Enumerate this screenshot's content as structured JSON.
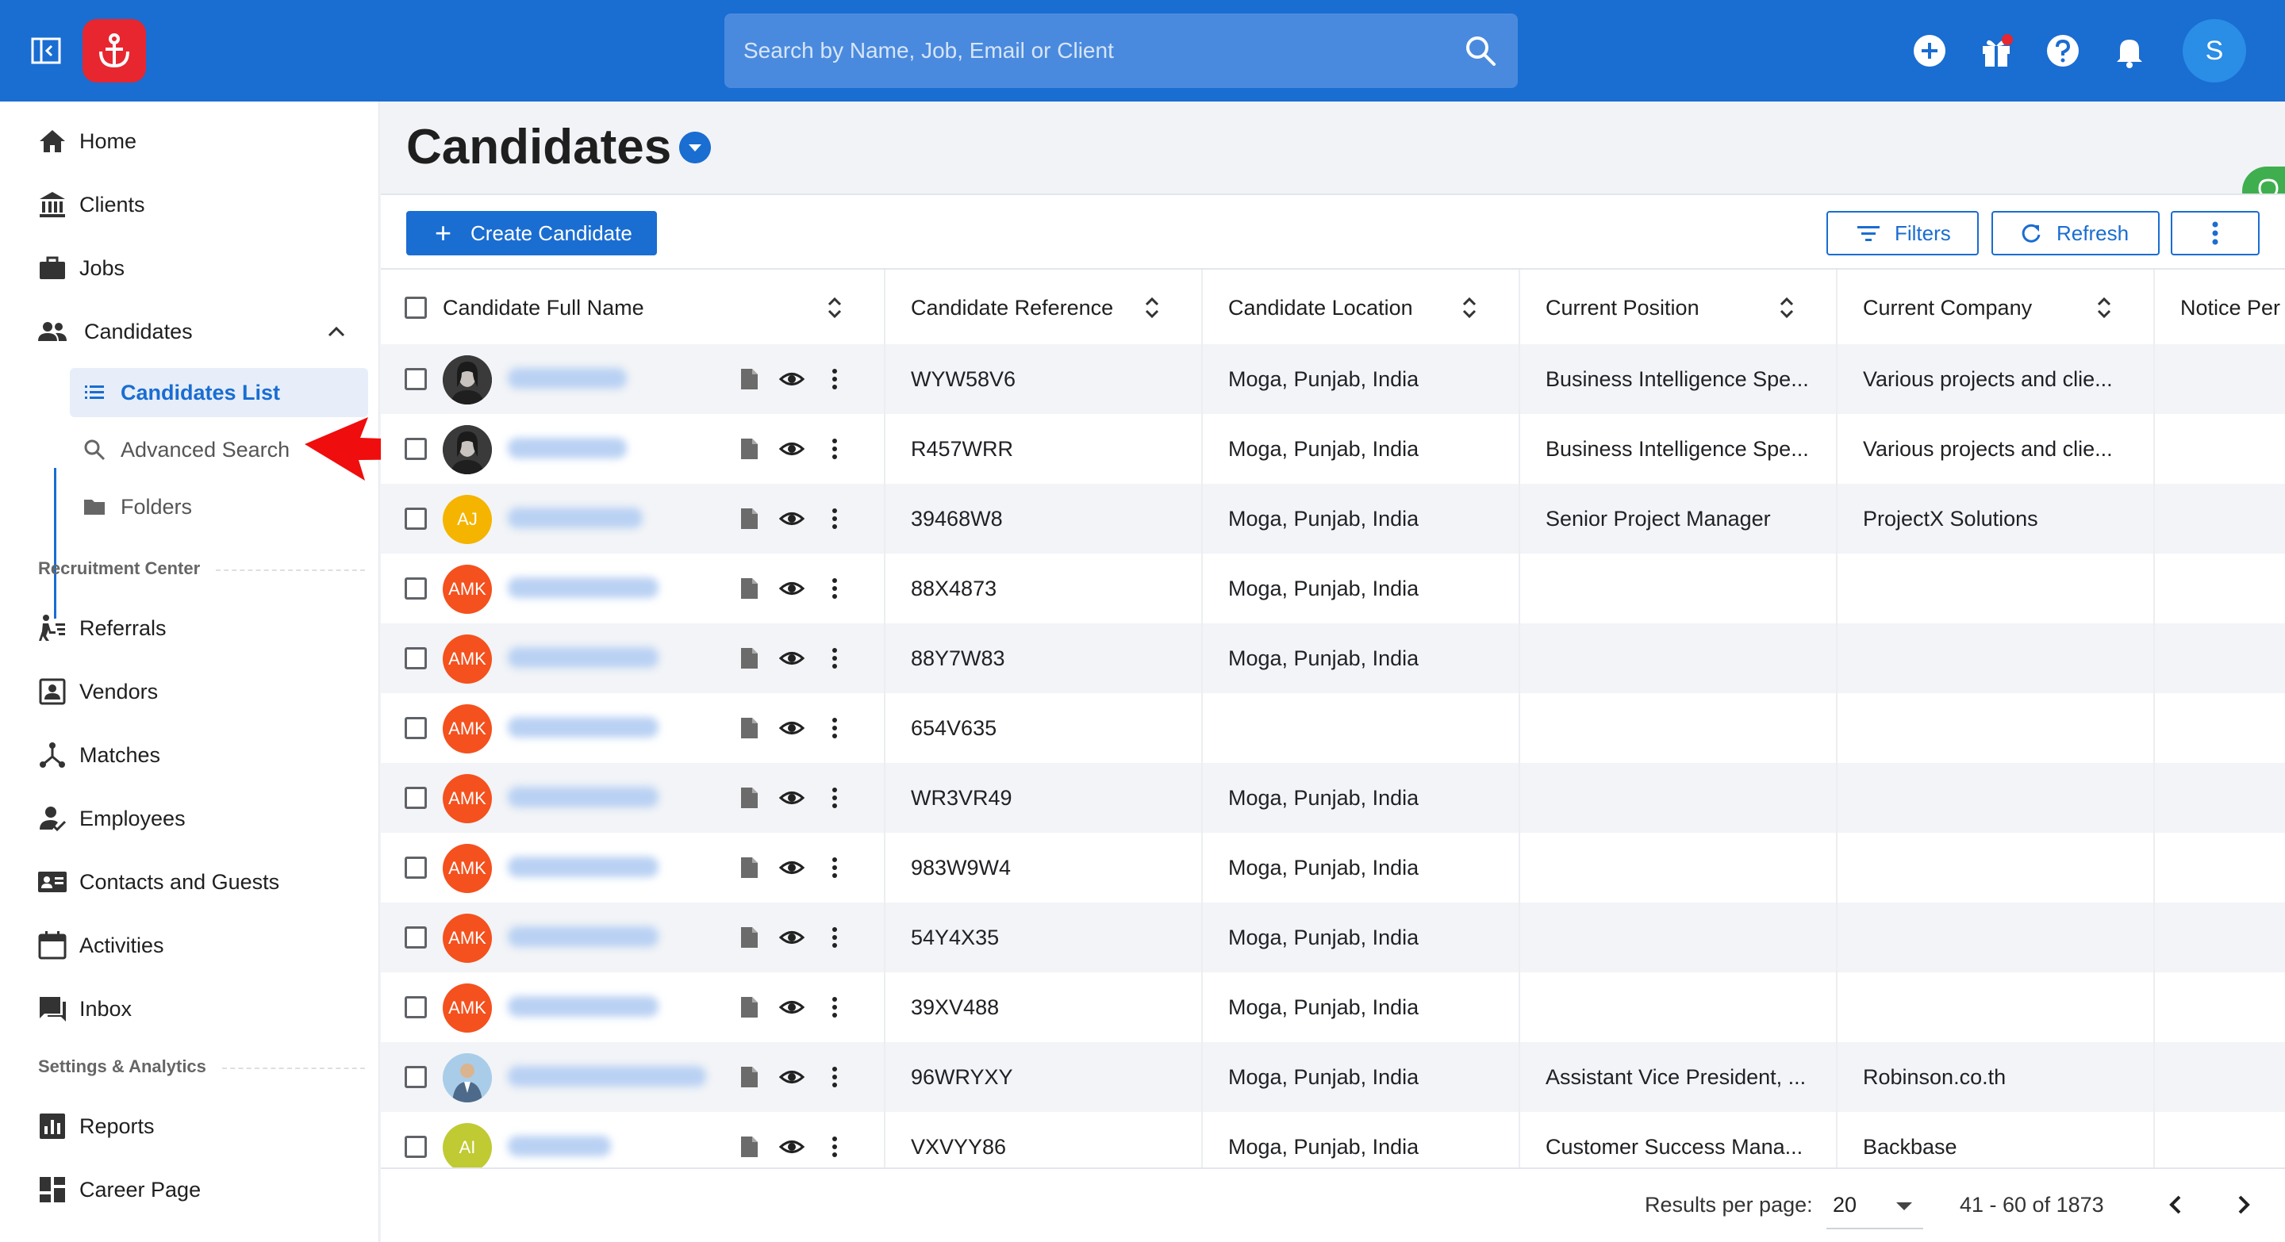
{
  "header": {
    "search_placeholder": "Search by Name, Job, Email or Client",
    "avatar_initial": "S",
    "brand_color": "#1a6dd1"
  },
  "sidebar": {
    "items": [
      {
        "label": "Home",
        "icon": "home-icon"
      },
      {
        "label": "Clients",
        "icon": "bank-icon"
      },
      {
        "label": "Jobs",
        "icon": "briefcase-icon"
      },
      {
        "label": "Candidates",
        "icon": "people-icon",
        "expanded": true
      }
    ],
    "candidates_sub": [
      {
        "label": "Candidates List",
        "icon": "list-icon",
        "active": true
      },
      {
        "label": "Advanced Search",
        "icon": "search-icon"
      },
      {
        "label": "Folders",
        "icon": "folder-icon"
      }
    ],
    "section_recruitment": "Recruitment Center",
    "recruitment_items": [
      {
        "label": "Referrals",
        "icon": "referral-icon"
      },
      {
        "label": "Vendors",
        "icon": "vendor-icon"
      },
      {
        "label": "Matches",
        "icon": "matches-icon"
      },
      {
        "label": "Employees",
        "icon": "employee-icon"
      },
      {
        "label": "Contacts and Guests",
        "icon": "contacts-icon"
      },
      {
        "label": "Activities",
        "icon": "calendar-icon"
      },
      {
        "label": "Inbox",
        "icon": "inbox-icon"
      }
    ],
    "section_settings": "Settings & Analytics",
    "settings_items": [
      {
        "label": "Reports",
        "icon": "reports-icon"
      },
      {
        "label": "Career Page",
        "icon": "dashboard-icon"
      }
    ]
  },
  "main": {
    "title": "Candidates",
    "create_label": "Create Candidate",
    "filters_label": "Filters",
    "refresh_label": "Refresh"
  },
  "table": {
    "columns": [
      "Candidate Full Name",
      "Candidate Reference",
      "Candidate Location",
      "Current Position",
      "Current Company",
      "Notice Per"
    ],
    "rows": [
      {
        "avatar": "photo",
        "initials": "",
        "ref": "WYW58V6",
        "location": "Moga, Punjab, India",
        "position": "Business Intelligence Spe...",
        "company": "Various projects and clie..."
      },
      {
        "avatar": "photo",
        "initials": "",
        "ref": "R457WRR",
        "location": "Moga, Punjab, India",
        "position": "Business Intelligence Spe...",
        "company": "Various projects and clie..."
      },
      {
        "avatar": "initials",
        "initials": "AJ",
        "color": "#f5b400",
        "ref": "39468W8",
        "location": "Moga, Punjab, India",
        "position": "Senior Project Manager",
        "company": "ProjectX Solutions"
      },
      {
        "avatar": "initials",
        "initials": "AMK",
        "color": "#f4511e",
        "ref": "88X4873",
        "location": "Moga, Punjab, India",
        "position": "",
        "company": ""
      },
      {
        "avatar": "initials",
        "initials": "AMK",
        "color": "#f4511e",
        "ref": "88Y7W83",
        "location": "Moga, Punjab, India",
        "position": "",
        "company": ""
      },
      {
        "avatar": "initials",
        "initials": "AMK",
        "color": "#f4511e",
        "ref": "654V635",
        "location": "",
        "position": "",
        "company": ""
      },
      {
        "avatar": "initials",
        "initials": "AMK",
        "color": "#f4511e",
        "ref": "WR3VR49",
        "location": "Moga, Punjab, India",
        "position": "",
        "company": ""
      },
      {
        "avatar": "initials",
        "initials": "AMK",
        "color": "#f4511e",
        "ref": "983W9W4",
        "location": "Moga, Punjab, India",
        "position": "",
        "company": ""
      },
      {
        "avatar": "initials",
        "initials": "AMK",
        "color": "#f4511e",
        "ref": "54Y4X35",
        "location": "Moga, Punjab, India",
        "position": "",
        "company": ""
      },
      {
        "avatar": "initials",
        "initials": "AMK",
        "color": "#f4511e",
        "ref": "39XV488",
        "location": "Moga, Punjab, India",
        "position": "",
        "company": ""
      },
      {
        "avatar": "photo2",
        "initials": "",
        "ref": "96WRYXY",
        "location": "Moga, Punjab, India",
        "position": "Assistant Vice President, ...",
        "company": "Robinson.co.th"
      },
      {
        "avatar": "initials",
        "initials": "AI",
        "color": "#c0ca33",
        "ref": "VXVYY86",
        "location": "Moga, Punjab, India",
        "position": "Customer Success Mana...",
        "company": "Backbase"
      }
    ]
  },
  "footer": {
    "results_label": "Results per page:",
    "per_page": "20",
    "range": "41 - 60 of 1873"
  }
}
